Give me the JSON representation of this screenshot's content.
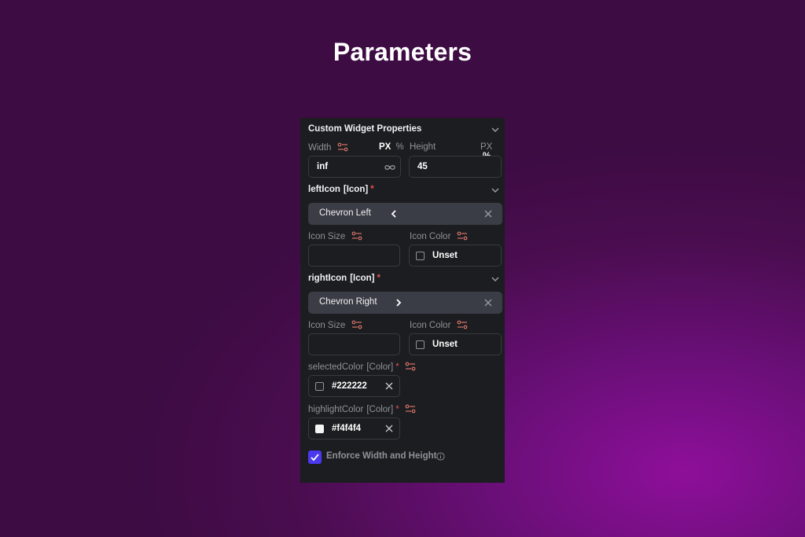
{
  "page_title": "Parameters",
  "panel": {
    "title": "Custom Widget Properties",
    "width": {
      "label": "Width",
      "unit_px": "PX",
      "unit_pct": "%",
      "value": "inf"
    },
    "height": {
      "label": "Height",
      "unit_px": "PX",
      "unit_pct": "%",
      "value": "45"
    },
    "left_icon": {
      "name": "leftIcon",
      "type": "[Icon]",
      "required": "*",
      "selected": "Chevron Left",
      "icon_size_label": "Icon Size",
      "icon_color_label": "Icon Color",
      "icon_color_value": "Unset"
    },
    "right_icon": {
      "name": "rightIcon",
      "type": "[Icon]",
      "required": "*",
      "selected": "Chevron Right",
      "icon_size_label": "Icon Size",
      "icon_color_label": "Icon Color",
      "icon_color_value": "Unset"
    },
    "selected_color": {
      "name": "selectedColor",
      "type": "[Color]",
      "required": "*",
      "value": "#222222",
      "swatch": "#222222"
    },
    "highlight_color": {
      "name": "highlightColor",
      "type": "[Color]",
      "required": "*",
      "value": "#f4f4f4",
      "swatch": "#f4f4f4"
    },
    "enforce": {
      "label": "Enforce Width and Height",
      "checked": true
    }
  },
  "colors": {
    "accent": "#4b39ef",
    "panel_bg": "#1c1d20",
    "chip_bg": "#3a3d45",
    "tune_icon": "#d9746a"
  }
}
